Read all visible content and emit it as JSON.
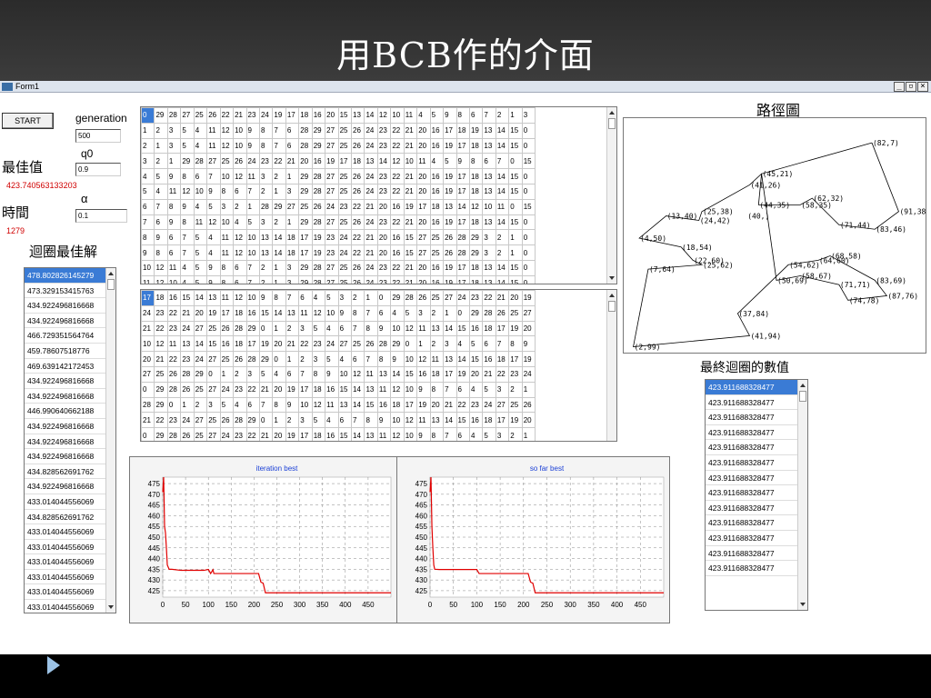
{
  "slide": {
    "title": "用BCB作的介面"
  },
  "window": {
    "title": "Form1",
    "min": "_",
    "max": "▫",
    "close": "×"
  },
  "controls": {
    "start_label": "START",
    "generation_label": "generation",
    "generation_value": "500",
    "q0_label": "q0",
    "q0_value": "0.9",
    "best_label": "最佳值",
    "best_value": "423.740563133203",
    "time_label": "時間",
    "time_value": "1279",
    "alpha_label": "α",
    "alpha_value": "0.1"
  },
  "loop_best": {
    "title": "迴圈最佳解",
    "items": [
      "478.802826145279",
      "473.329153415763",
      "434.922496816668",
      "434.922496816668",
      "466.729351564764",
      "459.78607518776",
      "469.639142172453",
      "434.922496816668",
      "434.922496816668",
      "446.990640662188",
      "434.922496816668",
      "434.922496816668",
      "434.922496816668",
      "434.828562691762",
      "434.922496816668",
      "433.014044556069",
      "434.828562691762",
      "433.014044556069",
      "433.014044556069",
      "433.014044556069",
      "433.014044556069",
      "433.014044556069",
      "433.014044556069"
    ]
  },
  "final_loop": {
    "title": "最終迴圈的數值",
    "items": [
      "423.911688328477",
      "423.911688328477",
      "423.911688328477",
      "423.911688328477",
      "423.911688328477",
      "423.911688328477",
      "423.911688328477",
      "423.911688328477",
      "423.911688328477",
      "423.911688328477",
      "423.911688328477",
      "423.911688328477",
      "423.911688328477"
    ]
  },
  "grid_top": [
    "0 29 28 27 25 26 22 21 23 24 19 17 18 16 20 15 13 14 12 10 11 4 5 9 8 6 7 2 1 3",
    "1 2 3 5 4 11 12 10 9 8 7 6 28 29 27 25 26 24 23 22 21 20 16 17 18 19 13 14 15 0",
    "2 1 3 5 4 11 12 10 9 8 7 6 28 29 27 25 26 24 23 22 21 20 16 19 17 18 13 14 15 0",
    "3 2 1 29 28 27 25 26 24 23 22 21 20 16 19 17 18 13 14 12 10 11 4 5 9 8 6 7 0 15",
    "4 5 9 8 6 7 10 12 11 3 2 1 29 28 27 25 26 24 23 22 21 20 16 19 17 18 13 14 15 0",
    "5 4 11 12 10 9 8 6 7 2 1 3 29 28 27 25 26 24 23 22 21 20 16 19 17 18 13 14 15 0",
    "6 7 8 9 4 5 3 2 1 28 29 27 25 26 24 23 22 21 20 16 19 17 18 13 14 12 10 11 0 15",
    "7 6 9 8 11 12 10 4 5 3 2 1 29 28 27 25 26 24 23 22 21 20 16 19 17 18 13 14 15 0",
    "8 9 6 7 5 4 11 12 10 13 14 18 17 19 23 24 22 21 20 16 15 27 25 26 28 29 3 2 1 0",
    "9 8 6 7 5 4 11 12 10 13 14 18 17 19 23 24 22 21 20 16 15 27 25 26 28 29 3 2 1 0",
    "10 12 11 4 5 9 8 6 7 2 1 3 29 28 27 25 26 24 23 22 21 20 16 19 17 18 13 14 15 0",
    "11 12 10 4 5 9 8 6 7 2 1 3 29 28 27 25 26 24 23 22 21 20 16 19 17 18 13 14 15 0"
  ],
  "grid_bottom": [
    "17 18 16 15 14 13 11 12 10 9 8 7 6 4 5 3 2 1 0 29 28 26 25 27 24 23 22 21 20 19",
    "24 23 22 21 20 19 17 18 16 15 14 13 11 12 10 9 8 7 6 4 5 3 2 1 0 29 28 26 25 27",
    "21 22 23 24 27 25 26 28 29 0 1 2 3 5 4 6 7 8 9 10 12 11 13 14 15 16 18 17 19 20",
    "10 12 11 13 14 15 16 18 17 19 20 21 22 23 24 27 25 26 28 29 0 1 2 3 4 5 6 7 8 9",
    "20 21 22 23 24 27 25 26 28 29 0 1 2 3 5 4 6 7 8 9 10 12 11 13 14 15 16 18 17 19",
    "27 25 26 28 29 0 1 2 3 5 4 6 7 8 9 10 12 11 13 14 15 16 18 17 19 20 21 22 23 24",
    "0 29 28 26 25 27 24 23 22 21 20 19 17 18 16 15 14 13 11 12 10 9 8 7 6 4 5 3 2 1",
    "28 29 0 1 2 3 5 4 6 7 8 9 10 12 11 13 14 15 16 18 17 19 20 21 22 23 24 27 25 26",
    "21 22 23 24 27 25 26 28 29 0 1 2 3 5 4 6 7 8 9 10 12 11 13 14 15 16 18 17 19 20",
    "0 29 28 26 25 27 24 23 22 21 20 19 17 18 16 15 14 13 11 12 10 9 8 7 6 4 5 3 2 1"
  ],
  "path": {
    "title": "路徑圖",
    "labels": [
      "(82,7)",
      "(45,21)",
      "(41,26)",
      "(62,32)",
      "(44,35)",
      "(58,35)",
      "(25,38)",
      "(24,42)",
      "(13,40)",
      "(40,)",
      "(91,38)",
      "(71,44)",
      "(83,46)",
      "(4,50)",
      "(18,54)",
      "(7,64)",
      "(22,60)",
      "(25,62)",
      "(68,58)",
      "(54,62)",
      "(64,60)",
      "(58,67)",
      "(50,69)",
      "(71,71)",
      "(83,69)",
      "(74,78)",
      "(87,76)",
      "(37,84)",
      "(41,94)",
      "(2,99)"
    ],
    "tour": [
      [
        82,
        7
      ],
      [
        91,
        38
      ],
      [
        83,
        46
      ],
      [
        71,
        44
      ],
      [
        62,
        32
      ],
      [
        58,
        35
      ],
      [
        44,
        35
      ],
      [
        45,
        21
      ],
      [
        41,
        26
      ],
      [
        25,
        38
      ],
      [
        24,
        42
      ],
      [
        13,
        40
      ],
      [
        4,
        50
      ],
      [
        18,
        54
      ],
      [
        22,
        60
      ],
      [
        25,
        62
      ],
      [
        7,
        64
      ],
      [
        2,
        99
      ],
      [
        41,
        94
      ],
      [
        37,
        84
      ],
      [
        54,
        62
      ],
      [
        64,
        60
      ],
      [
        68,
        58
      ],
      [
        83,
        69
      ],
      [
        87,
        76
      ],
      [
        74,
        78
      ],
      [
        71,
        71
      ],
      [
        58,
        67
      ],
      [
        50,
        69
      ],
      [
        45,
        21
      ],
      [
        82,
        7
      ]
    ]
  },
  "chart_data": [
    {
      "type": "line",
      "title": "iteration best",
      "xlim": [
        0,
        500
      ],
      "ylim": [
        422,
        478
      ],
      "xticks": [
        0,
        50,
        100,
        150,
        200,
        250,
        300,
        350,
        400,
        450
      ],
      "yticks": [
        425,
        430,
        435,
        440,
        445,
        450,
        455,
        460,
        465,
        470,
        475
      ],
      "color": "#e00000",
      "x": [
        0,
        2,
        4,
        6,
        8,
        10,
        14,
        20,
        40,
        60,
        90,
        100,
        105,
        110,
        112,
        130,
        160,
        200,
        210,
        215,
        220,
        225,
        250,
        300,
        400,
        500
      ],
      "y": [
        471,
        478,
        455,
        452,
        445,
        437,
        435,
        435,
        434.5,
        434.5,
        434.5,
        434.9,
        433,
        434.8,
        433,
        433,
        433,
        433,
        433,
        429,
        428.5,
        424,
        424,
        424,
        424,
        424
      ]
    },
    {
      "type": "line",
      "title": "so far best",
      "xlim": [
        0,
        500
      ],
      "ylim": [
        422,
        478
      ],
      "xticks": [
        0,
        50,
        100,
        150,
        200,
        250,
        300,
        350,
        400,
        450
      ],
      "yticks": [
        425,
        430,
        435,
        440,
        445,
        450,
        455,
        460,
        465,
        470,
        475
      ],
      "color": "#e00000",
      "x": [
        0,
        2,
        4,
        6,
        8,
        10,
        20,
        60,
        100,
        105,
        110,
        120,
        200,
        210,
        215,
        220,
        225,
        250,
        300,
        400,
        500
      ],
      "y": [
        471,
        478,
        455,
        445,
        437,
        435,
        434.9,
        434.9,
        434.9,
        433,
        433,
        433,
        433,
        433,
        429,
        428.5,
        424,
        424,
        424,
        424,
        424
      ]
    }
  ]
}
